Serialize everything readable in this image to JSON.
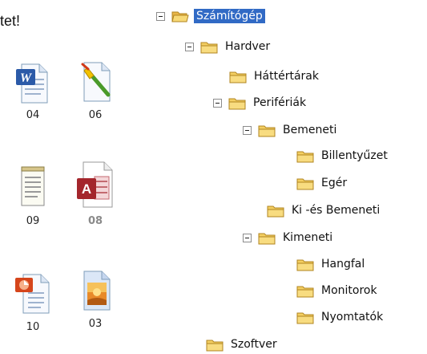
{
  "intro_text": "tet!",
  "files": [
    {
      "caption": "04",
      "icon": "word-document-icon"
    },
    {
      "caption": "06",
      "icon": "paint-brush-icon"
    },
    {
      "caption": "09",
      "icon": "notepad-icon"
    },
    {
      "caption": "08",
      "icon": "access-database-icon"
    },
    {
      "caption": "10",
      "icon": "powerpoint-icon"
    },
    {
      "caption": "03",
      "icon": "image-file-icon"
    }
  ],
  "tree": [
    {
      "label": "Számítógép",
      "selected": true,
      "expanded": true
    },
    {
      "label": "Hardver",
      "expanded": true
    },
    {
      "label": "Háttértárak"
    },
    {
      "label": "Perifériák",
      "expanded": true
    },
    {
      "label": "Bemeneti",
      "expanded": true
    },
    {
      "label": "Billentyűzet"
    },
    {
      "label": "Egér"
    },
    {
      "label": "Ki -és Bemeneti"
    },
    {
      "label": "Kimeneti",
      "expanded": true
    },
    {
      "label": "Hangfal"
    },
    {
      "label": "Monitorok"
    },
    {
      "label": "Nyomtatók"
    },
    {
      "label": "Szoftver"
    }
  ],
  "colors": {
    "selection": "#316ac5",
    "folder": "#f4cf62"
  }
}
